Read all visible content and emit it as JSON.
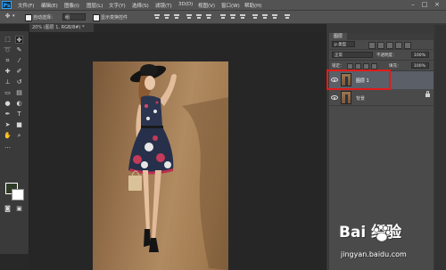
{
  "app": {
    "logo_text": "Ps"
  },
  "menu": {
    "items": [
      "文件(F)",
      "编辑(E)",
      "图像(I)",
      "图层(L)",
      "文字(Y)",
      "选择(S)",
      "滤镜(T)",
      "3D(D)",
      "视图(V)",
      "窗口(W)",
      "帮助(H)"
    ]
  },
  "window_controls": {
    "minimize": "–",
    "maximize": "□",
    "close": "×"
  },
  "options_bar": {
    "auto_select_label": "自动选择：",
    "auto_select_value": "组",
    "show_transform_label": "显示变换控件"
  },
  "document": {
    "tab_title": "20% (图层 1, RGB/8#) *"
  },
  "layers_panel": {
    "tab_label": "图层",
    "filter_type": "p 类型",
    "blend_mode": "正常",
    "opacity_label": "不透明度：",
    "opacity_value": "100%",
    "lock_label": "锁定：",
    "fill_label": "填充：",
    "fill_value": "100%",
    "layers": [
      {
        "name": "图层 1",
        "selected": true
      },
      {
        "name": "背景",
        "selected": false
      }
    ]
  },
  "watermark": {
    "brand": "Bai  经验",
    "url": "jingyan.baidu.com"
  },
  "colors": {
    "app_bg": "#282828",
    "panel_bg": "#4a4a4a",
    "selection": "#5a5f68",
    "highlight": "#e11c1c",
    "foreground_swatch": "#2f3b27",
    "background_swatch": "#ffffff"
  }
}
